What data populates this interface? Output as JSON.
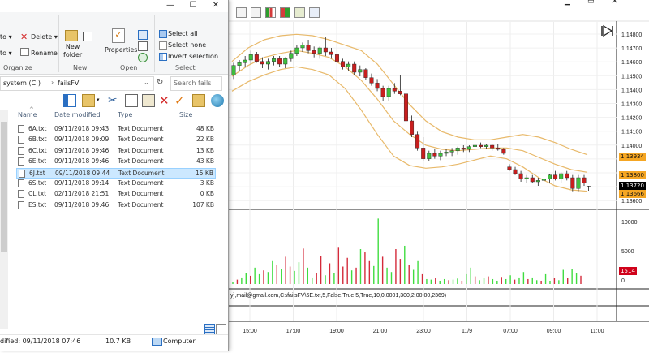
{
  "chart_toolbar": {
    "icons": [
      "select-icon",
      "zoom-icon",
      "bar-chart-icon",
      "indicator-icon",
      "template-icon",
      "properties-icon"
    ],
    "window_icons": [
      "minimize-icon",
      "restore-icon",
      "close-icon"
    ]
  },
  "price_axis": {
    "ticks": [
      "1.14800",
      "1.14700",
      "1.14600",
      "1.14500",
      "1.14400",
      "1.14300",
      "1.14200",
      "1.14100",
      "1.14000",
      "1.13900",
      "1.13800",
      "1.13700",
      "1.13600"
    ],
    "badges": [
      {
        "label": "1.13934",
        "color": "#f5a623"
      },
      {
        "label": "1.13800",
        "color": "#f5a623"
      },
      {
        "label": "1.13720",
        "color": "#000000"
      },
      {
        "label": "1.13666",
        "color": "#f5a623"
      }
    ],
    "last_marker": "T"
  },
  "volume_axis": {
    "ticks": [
      "10000",
      "5000",
      "0"
    ],
    "badge": {
      "label": "1514",
      "color": "#d0021b"
    }
  },
  "time_axis": {
    "ticks": [
      "15:00",
      "17:00",
      "19:00",
      "21:00",
      "23:00",
      "11/9",
      "07:00",
      "09:00",
      "11:00"
    ]
  },
  "strategy_label": "y],mail@gmail.com,C:\\failsFV\\6E.txt,5,False,True,5,True,10,0.0001,300,2,00:00,2369)",
  "chart_data": {
    "type": "candlestick",
    "price_ylim": [
      1.1355,
      1.1487
    ],
    "candles_ohlc": [
      [
        1.1452,
        1.1461,
        1.1449,
        1.1459
      ],
      [
        1.1459,
        1.1463,
        1.1455,
        1.1461
      ],
      [
        1.1461,
        1.1466,
        1.1458,
        1.1463
      ],
      [
        1.1463,
        1.147,
        1.146,
        1.1467
      ],
      [
        1.1467,
        1.1469,
        1.1461,
        1.1462
      ],
      [
        1.1462,
        1.1465,
        1.1457,
        1.146
      ],
      [
        1.146,
        1.1464,
        1.1456,
        1.1462
      ],
      [
        1.1462,
        1.1466,
        1.1459,
        1.1464
      ],
      [
        1.1464,
        1.1466,
        1.1458,
        1.146
      ],
      [
        1.146,
        1.1465,
        1.1457,
        1.1464
      ],
      [
        1.1464,
        1.147,
        1.1462,
        1.1468
      ],
      [
        1.1468,
        1.1474,
        1.1466,
        1.1472
      ],
      [
        1.1472,
        1.1476,
        1.1469,
        1.1474
      ],
      [
        1.1474,
        1.1478,
        1.1468,
        1.147
      ],
      [
        1.147,
        1.1473,
        1.1465,
        1.1468
      ],
      [
        1.1468,
        1.1473,
        1.1464,
        1.1472
      ],
      [
        1.1472,
        1.148,
        1.1466,
        1.1469
      ],
      [
        1.1469,
        1.1472,
        1.1464,
        1.1467
      ],
      [
        1.1467,
        1.1469,
        1.146,
        1.1462
      ],
      [
        1.1462,
        1.1464,
        1.1456,
        1.1458
      ],
      [
        1.1458,
        1.1462,
        1.1455,
        1.146
      ],
      [
        1.146,
        1.1462,
        1.1452,
        1.1454
      ],
      [
        1.1454,
        1.1459,
        1.1451,
        1.1456
      ],
      [
        1.1456,
        1.1457,
        1.1448,
        1.145
      ],
      [
        1.145,
        1.1453,
        1.1444,
        1.1446
      ],
      [
        1.1446,
        1.1449,
        1.144,
        1.1442
      ],
      [
        1.1442,
        1.1444,
        1.1433,
        1.1436
      ],
      [
        1.1436,
        1.1444,
        1.1433,
        1.1442
      ],
      [
        1.1442,
        1.1446,
        1.1438,
        1.144
      ],
      [
        1.144,
        1.1452,
        1.1437,
        1.1438
      ],
      [
        1.1438,
        1.144,
        1.1414,
        1.1418
      ],
      [
        1.1418,
        1.1422,
        1.1406,
        1.1408
      ],
      [
        1.1408,
        1.141,
        1.1396,
        1.1398
      ],
      [
        1.1398,
        1.1406,
        1.1388,
        1.139
      ],
      [
        1.139,
        1.1396,
        1.1388,
        1.1394
      ],
      [
        1.1394,
        1.1397,
        1.139,
        1.1392
      ],
      [
        1.1392,
        1.1396,
        1.1389,
        1.1394
      ],
      [
        1.1394,
        1.1397,
        1.1392,
        1.1395
      ],
      [
        1.1395,
        1.1398,
        1.1392,
        1.1396
      ],
      [
        1.1396,
        1.1399,
        1.1393,
        1.1398
      ],
      [
        1.1398,
        1.14,
        1.1395,
        1.1397
      ],
      [
        1.1397,
        1.14,
        1.1395,
        1.1399
      ],
      [
        1.1399,
        1.1402,
        1.1397,
        1.14
      ],
      [
        1.14,
        1.1402,
        1.1398,
        1.1399
      ],
      [
        1.1399,
        1.1401,
        1.1397,
        1.14
      ],
      [
        1.14,
        1.1401,
        1.1396,
        1.1398
      ],
      [
        1.1398,
        1.1401,
        1.1396,
        1.1397
      ],
      [
        1.1397,
        1.1398,
        1.1393,
        1.1394
      ],
      [
        1.1384,
        1.1386,
        1.1381,
        1.1382
      ],
      [
        1.1382,
        1.1384,
        1.1378,
        1.1379
      ],
      [
        1.1379,
        1.1381,
        1.1373,
        1.1375
      ],
      [
        1.1375,
        1.1378,
        1.1372,
        1.1376
      ],
      [
        1.1376,
        1.1378,
        1.1372,
        1.1373
      ],
      [
        1.1373,
        1.1376,
        1.137,
        1.1374
      ],
      [
        1.1374,
        1.1377,
        1.1371,
        1.1375
      ],
      [
        1.1375,
        1.1379,
        1.1372,
        1.1378
      ],
      [
        1.1378,
        1.1381,
        1.1374,
        1.1375
      ],
      [
        1.1375,
        1.138,
        1.1372,
        1.1379
      ],
      [
        1.1379,
        1.1381,
        1.1374,
        1.1376
      ],
      [
        1.1376,
        1.1378,
        1.1366,
        1.1368
      ],
      [
        1.1368,
        1.1378,
        1.1366,
        1.1376
      ],
      [
        1.1376,
        1.1378,
        1.137,
        1.1372
      ]
    ],
    "bollinger_upper": [
      1.1462,
      1.1472,
      1.1478,
      1.1481,
      1.1482,
      1.1481,
      1.1478,
      1.1474,
      1.147,
      1.146,
      1.1445,
      1.143,
      1.1418,
      1.141,
      1.1406,
      1.1404,
      1.1404,
      1.1406,
      1.1408,
      1.1406,
      1.1402,
      1.1397,
      1.1393
    ],
    "bollinger_lower": [
      1.144,
      1.1447,
      1.1452,
      1.1456,
      1.1458,
      1.1456,
      1.1452,
      1.1442,
      1.1426,
      1.1408,
      1.1392,
      1.1385,
      1.1383,
      1.1384,
      1.1386,
      1.1389,
      1.1392,
      1.139,
      1.1384,
      1.1376,
      1.137,
      1.1367,
      1.1366
    ],
    "bollinger_mid": [
      1.1451,
      1.1459,
      1.1465,
      1.1468,
      1.147,
      1.1468,
      1.1465,
      1.1458,
      1.1448,
      1.1434,
      1.1418,
      1.1408,
      1.14,
      1.1397,
      1.1396,
      1.1397,
      1.1398,
      1.1398,
      1.1396,
      1.1391,
      1.1386,
      1.1382,
      1.138
    ],
    "volume": [
      300,
      800,
      1200,
      2000,
      1500,
      3000,
      1800,
      2500,
      2200,
      4200,
      3500,
      2800,
      5000,
      3200,
      2400,
      4000,
      6500,
      3000,
      1200,
      2000,
      5200,
      1600,
      3800,
      2000,
      6800,
      3200,
      4800,
      2500,
      3000,
      6400,
      5800,
      4200,
      3300,
      12000,
      5000,
      3000,
      2200,
      6400,
      4600,
      7000,
      3500,
      2600,
      4200,
      1800,
      900,
      800,
      1100,
      600,
      900,
      700,
      800,
      1000,
      600,
      1800,
      3000,
      1400,
      700,
      1100,
      1400,
      900,
      600,
      1300,
      900,
      1600,
      800,
      1200,
      2200,
      900,
      1200,
      700,
      600,
      1800,
      600,
      1100,
      700,
      2600,
      1100,
      2800,
      2000,
      1514
    ],
    "volume_ylim": [
      0,
      12500
    ]
  },
  "explorer": {
    "ribbon": {
      "copy_to": "to ▾",
      "move_to": "to ▾",
      "delete": "Delete ▾",
      "rename": "Rename",
      "new_folder": "New\nfolder",
      "properties": "Properties",
      "select_all": "Select all",
      "select_none": "Select none",
      "invert_selection": "Invert selection",
      "groups": [
        "Organize",
        "New",
        "Open",
        "Select"
      ]
    },
    "address": [
      "system (C:)",
      "failsFV"
    ],
    "search_placeholder": "Search fails",
    "columns": [
      "Name",
      "Date modified",
      "Type",
      "Size"
    ],
    "files": [
      {
        "name": "6A.txt",
        "date": "09/11/2018 09:43",
        "type": "Text Document",
        "size": "48 KB",
        "selected": false
      },
      {
        "name": "6B.txt",
        "date": "09/11/2018 09:09",
        "type": "Text Document",
        "size": "22 KB",
        "selected": false
      },
      {
        "name": "6C.txt",
        "date": "09/11/2018 09:46",
        "type": "Text Document",
        "size": "13 KB",
        "selected": false
      },
      {
        "name": "6E.txt",
        "date": "09/11/2018 09:46",
        "type": "Text Document",
        "size": "43 KB",
        "selected": false
      },
      {
        "name": "6J.txt",
        "date": "09/11/2018 09:44",
        "type": "Text Document",
        "size": "15 KB",
        "selected": true
      },
      {
        "name": "6S.txt",
        "date": "09/11/2018 09:14",
        "type": "Text Document",
        "size": "3 KB",
        "selected": false
      },
      {
        "name": "CL.txt",
        "date": "02/11/2018 21:51",
        "type": "Text Document",
        "size": "0 KB",
        "selected": false
      },
      {
        "name": "ES.txt",
        "date": "09/11/2018 09:46",
        "type": "Text Document",
        "size": "107 KB",
        "selected": false
      }
    ],
    "status": {
      "modified": "dified: 09/11/2018 07:46",
      "size": "10.7 KB",
      "location": "Computer"
    }
  }
}
